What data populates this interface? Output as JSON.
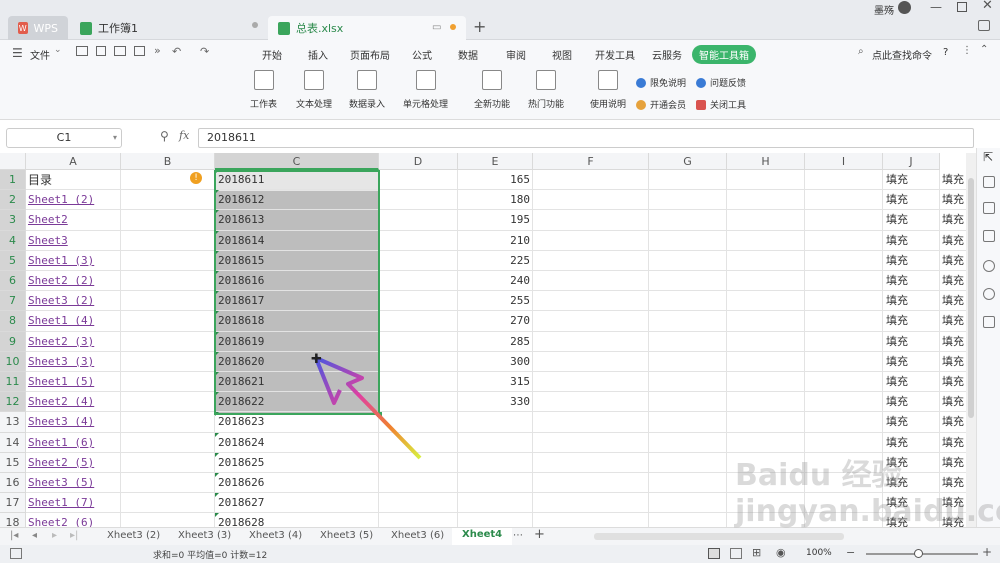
{
  "titlebar": {
    "tabs": [
      {
        "label": "WPS"
      },
      {
        "label": "工作簿1"
      },
      {
        "label": "总表.xlsx"
      }
    ],
    "user": "墨殇"
  },
  "menubar": {
    "file": "文件",
    "items": [
      "开始",
      "插入",
      "页面布局",
      "公式",
      "数据",
      "审阅",
      "视图",
      "开发工具",
      "云服务",
      "智能工具箱"
    ],
    "search": "点此查找命令",
    "help": "?"
  },
  "ribbon": {
    "buttons": [
      "工作表",
      "文本处理",
      "数据录入",
      "单元格处理",
      "全新功能",
      "热门功能",
      "使用说明"
    ],
    "small": [
      "限免说明",
      "问题反馈",
      "开通会员",
      "关闭工具"
    ]
  },
  "formula_bar": {
    "cell_ref": "C1",
    "fx": "fx",
    "value": "2018611"
  },
  "columns": [
    "A",
    "B",
    "C",
    "D",
    "E",
    "F",
    "G",
    "H",
    "I",
    "J"
  ],
  "rows": [
    {
      "n": "1",
      "a": "目录",
      "c": "2018611",
      "e": "165",
      "j": "填充",
      "k": "填充"
    },
    {
      "n": "2",
      "a": "Sheet1 (2)",
      "c": "2018612",
      "e": "180",
      "j": "填充",
      "k": "填充"
    },
    {
      "n": "3",
      "a": "Sheet2",
      "c": "2018613",
      "e": "195",
      "j": "填充",
      "k": "填充"
    },
    {
      "n": "4",
      "a": "Sheet3",
      "c": "2018614",
      "e": "210",
      "j": "填充",
      "k": "填充"
    },
    {
      "n": "5",
      "a": "Sheet1 (3)",
      "c": "2018615",
      "e": "225",
      "j": "填充",
      "k": "填充"
    },
    {
      "n": "6",
      "a": "Sheet2 (2)",
      "c": "2018616",
      "e": "240",
      "j": "填充",
      "k": "填充"
    },
    {
      "n": "7",
      "a": "Sheet3 (2)",
      "c": "2018617",
      "e": "255",
      "j": "填充",
      "k": "填充"
    },
    {
      "n": "8",
      "a": "Sheet1 (4)",
      "c": "2018618",
      "e": "270",
      "j": "填充",
      "k": "填充"
    },
    {
      "n": "9",
      "a": "Sheet2 (3)",
      "c": "2018619",
      "e": "285",
      "j": "填充",
      "k": "填充"
    },
    {
      "n": "10",
      "a": "Sheet3 (3)",
      "c": "2018620",
      "e": "300",
      "j": "填充",
      "k": "填充"
    },
    {
      "n": "11",
      "a": "Sheet1 (5)",
      "c": "2018621",
      "e": "315",
      "j": "填充",
      "k": "填充"
    },
    {
      "n": "12",
      "a": "Sheet2 (4)",
      "c": "2018622",
      "e": "330",
      "j": "填充",
      "k": "填充"
    },
    {
      "n": "13",
      "a": "Sheet3 (4)",
      "c": "2018623",
      "e": "",
      "j": "填充",
      "k": "填充"
    },
    {
      "n": "14",
      "a": "Sheet1 (6)",
      "c": "2018624",
      "e": "",
      "j": "填充",
      "k": "填充"
    },
    {
      "n": "15",
      "a": "Sheet2 (5)",
      "c": "2018625",
      "e": "",
      "j": "填充",
      "k": "填充"
    },
    {
      "n": "16",
      "a": "Sheet3 (5)",
      "c": "2018626",
      "e": "",
      "j": "填充",
      "k": "填充"
    },
    {
      "n": "17",
      "a": "Sheet1 (7)",
      "c": "2018627",
      "e": "",
      "j": "填充",
      "k": "填充"
    },
    {
      "n": "18",
      "a": "Sheet2 (6)",
      "c": "2018628",
      "e": "",
      "j": "填充",
      "k": "填充"
    }
  ],
  "sheet_tabs": [
    "Xheet3 (2)",
    "Xheet3 (3)",
    "Xheet3 (4)",
    "Xheet3 (5)",
    "Xheet3 (6)",
    "Xheet4"
  ],
  "status": {
    "text": "求和=0  平均值=0  计数=12",
    "zoom": "100%"
  },
  "watermark": "Baidu 经验  jingyan.baidu.com"
}
